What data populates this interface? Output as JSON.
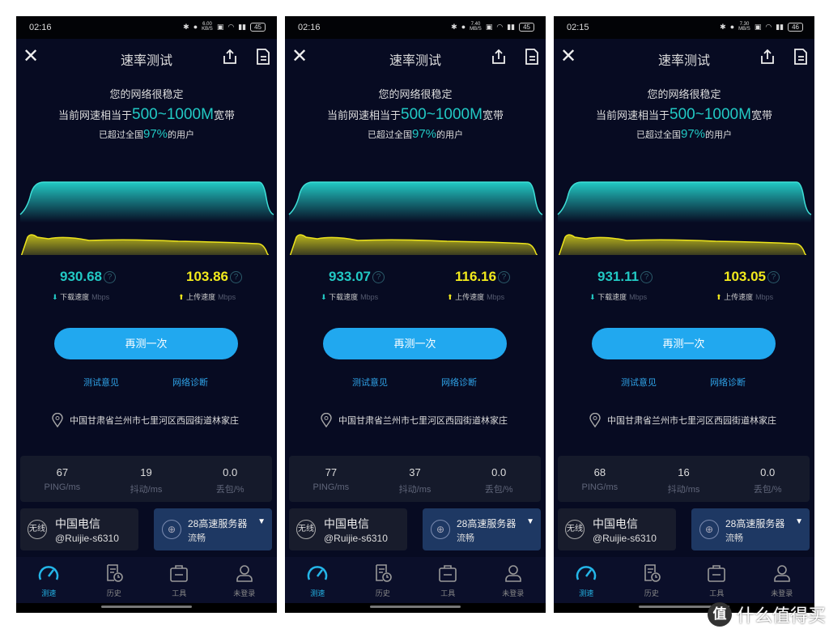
{
  "common": {
    "title": "速率测试",
    "stable": "您的网络很稳定",
    "equiv_prefix": "当前网速相当于",
    "equiv_value": "500~1000M",
    "equiv_suffix": "宽带",
    "beat_prefix": "已超过全国",
    "beat_value": "97%",
    "beat_suffix": "的用户",
    "download_label": "下载速度",
    "upload_label": "上传速度",
    "unit": "Mbps",
    "help": "?",
    "retest": "再测一次",
    "feedback": "测试意见",
    "diagnose": "网络诊断",
    "location": "中国甘肃省兰州市七里河区西园街道林家庄",
    "ping_label": "PING/ms",
    "jitter_label": "抖动/ms",
    "loss_label": "丢包/%",
    "conn_badge": "无线",
    "carrier": "中国电信",
    "ssid": "@Ruijie-s6310",
    "server": "28高速服务器",
    "server_status": "流畅",
    "nav": [
      "测速",
      "历史",
      "工具",
      "未登录"
    ],
    "accent_download": "#22c9c4",
    "accent_upload": "#f2ea1c",
    "accent_button": "#21a8ef"
  },
  "screens": [
    {
      "time": "02:16",
      "net_speed": "6.00",
      "net_unit": "KB/S",
      "battery": "45",
      "download": "930.68",
      "upload": "103.86",
      "ping": "67",
      "jitter": "19",
      "loss": "0.0"
    },
    {
      "time": "02:16",
      "net_speed": "7.40",
      "net_unit": "MB/S",
      "battery": "45",
      "download": "933.07",
      "upload": "116.16",
      "ping": "77",
      "jitter": "37",
      "loss": "0.0"
    },
    {
      "time": "02:15",
      "net_speed": "7.30",
      "net_unit": "MB/S",
      "battery": "46",
      "download": "931.11",
      "upload": "103.05",
      "ping": "68",
      "jitter": "16",
      "loss": "0.0"
    }
  ],
  "watermark": {
    "logo": "值",
    "text": "什么值得买"
  }
}
